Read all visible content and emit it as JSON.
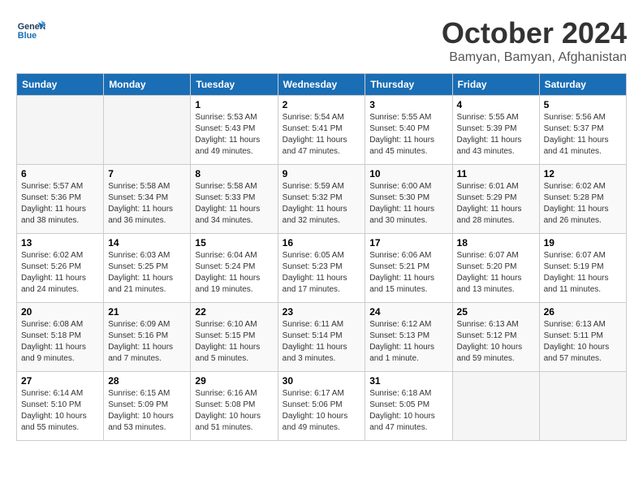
{
  "header": {
    "logo_general": "General",
    "logo_blue": "Blue",
    "month_title": "October 2024",
    "subtitle": "Bamyan, Bamyan, Afghanistan"
  },
  "days_of_week": [
    "Sunday",
    "Monday",
    "Tuesday",
    "Wednesday",
    "Thursday",
    "Friday",
    "Saturday"
  ],
  "weeks": [
    [
      {
        "day": "",
        "info": ""
      },
      {
        "day": "",
        "info": ""
      },
      {
        "day": "1",
        "sunrise": "Sunrise: 5:53 AM",
        "sunset": "Sunset: 5:43 PM",
        "daylight": "Daylight: 11 hours and 49 minutes."
      },
      {
        "day": "2",
        "sunrise": "Sunrise: 5:54 AM",
        "sunset": "Sunset: 5:41 PM",
        "daylight": "Daylight: 11 hours and 47 minutes."
      },
      {
        "day": "3",
        "sunrise": "Sunrise: 5:55 AM",
        "sunset": "Sunset: 5:40 PM",
        "daylight": "Daylight: 11 hours and 45 minutes."
      },
      {
        "day": "4",
        "sunrise": "Sunrise: 5:55 AM",
        "sunset": "Sunset: 5:39 PM",
        "daylight": "Daylight: 11 hours and 43 minutes."
      },
      {
        "day": "5",
        "sunrise": "Sunrise: 5:56 AM",
        "sunset": "Sunset: 5:37 PM",
        "daylight": "Daylight: 11 hours and 41 minutes."
      }
    ],
    [
      {
        "day": "6",
        "sunrise": "Sunrise: 5:57 AM",
        "sunset": "Sunset: 5:36 PM",
        "daylight": "Daylight: 11 hours and 38 minutes."
      },
      {
        "day": "7",
        "sunrise": "Sunrise: 5:58 AM",
        "sunset": "Sunset: 5:34 PM",
        "daylight": "Daylight: 11 hours and 36 minutes."
      },
      {
        "day": "8",
        "sunrise": "Sunrise: 5:58 AM",
        "sunset": "Sunset: 5:33 PM",
        "daylight": "Daylight: 11 hours and 34 minutes."
      },
      {
        "day": "9",
        "sunrise": "Sunrise: 5:59 AM",
        "sunset": "Sunset: 5:32 PM",
        "daylight": "Daylight: 11 hours and 32 minutes."
      },
      {
        "day": "10",
        "sunrise": "Sunrise: 6:00 AM",
        "sunset": "Sunset: 5:30 PM",
        "daylight": "Daylight: 11 hours and 30 minutes."
      },
      {
        "day": "11",
        "sunrise": "Sunrise: 6:01 AM",
        "sunset": "Sunset: 5:29 PM",
        "daylight": "Daylight: 11 hours and 28 minutes."
      },
      {
        "day": "12",
        "sunrise": "Sunrise: 6:02 AM",
        "sunset": "Sunset: 5:28 PM",
        "daylight": "Daylight: 11 hours and 26 minutes."
      }
    ],
    [
      {
        "day": "13",
        "sunrise": "Sunrise: 6:02 AM",
        "sunset": "Sunset: 5:26 PM",
        "daylight": "Daylight: 11 hours and 24 minutes."
      },
      {
        "day": "14",
        "sunrise": "Sunrise: 6:03 AM",
        "sunset": "Sunset: 5:25 PM",
        "daylight": "Daylight: 11 hours and 21 minutes."
      },
      {
        "day": "15",
        "sunrise": "Sunrise: 6:04 AM",
        "sunset": "Sunset: 5:24 PM",
        "daylight": "Daylight: 11 hours and 19 minutes."
      },
      {
        "day": "16",
        "sunrise": "Sunrise: 6:05 AM",
        "sunset": "Sunset: 5:23 PM",
        "daylight": "Daylight: 11 hours and 17 minutes."
      },
      {
        "day": "17",
        "sunrise": "Sunrise: 6:06 AM",
        "sunset": "Sunset: 5:21 PM",
        "daylight": "Daylight: 11 hours and 15 minutes."
      },
      {
        "day": "18",
        "sunrise": "Sunrise: 6:07 AM",
        "sunset": "Sunset: 5:20 PM",
        "daylight": "Daylight: 11 hours and 13 minutes."
      },
      {
        "day": "19",
        "sunrise": "Sunrise: 6:07 AM",
        "sunset": "Sunset: 5:19 PM",
        "daylight": "Daylight: 11 hours and 11 minutes."
      }
    ],
    [
      {
        "day": "20",
        "sunrise": "Sunrise: 6:08 AM",
        "sunset": "Sunset: 5:18 PM",
        "daylight": "Daylight: 11 hours and 9 minutes."
      },
      {
        "day": "21",
        "sunrise": "Sunrise: 6:09 AM",
        "sunset": "Sunset: 5:16 PM",
        "daylight": "Daylight: 11 hours and 7 minutes."
      },
      {
        "day": "22",
        "sunrise": "Sunrise: 6:10 AM",
        "sunset": "Sunset: 5:15 PM",
        "daylight": "Daylight: 11 hours and 5 minutes."
      },
      {
        "day": "23",
        "sunrise": "Sunrise: 6:11 AM",
        "sunset": "Sunset: 5:14 PM",
        "daylight": "Daylight: 11 hours and 3 minutes."
      },
      {
        "day": "24",
        "sunrise": "Sunrise: 6:12 AM",
        "sunset": "Sunset: 5:13 PM",
        "daylight": "Daylight: 11 hours and 1 minute."
      },
      {
        "day": "25",
        "sunrise": "Sunrise: 6:13 AM",
        "sunset": "Sunset: 5:12 PM",
        "daylight": "Daylight: 10 hours and 59 minutes."
      },
      {
        "day": "26",
        "sunrise": "Sunrise: 6:13 AM",
        "sunset": "Sunset: 5:11 PM",
        "daylight": "Daylight: 10 hours and 57 minutes."
      }
    ],
    [
      {
        "day": "27",
        "sunrise": "Sunrise: 6:14 AM",
        "sunset": "Sunset: 5:10 PM",
        "daylight": "Daylight: 10 hours and 55 minutes."
      },
      {
        "day": "28",
        "sunrise": "Sunrise: 6:15 AM",
        "sunset": "Sunset: 5:09 PM",
        "daylight": "Daylight: 10 hours and 53 minutes."
      },
      {
        "day": "29",
        "sunrise": "Sunrise: 6:16 AM",
        "sunset": "Sunset: 5:08 PM",
        "daylight": "Daylight: 10 hours and 51 minutes."
      },
      {
        "day": "30",
        "sunrise": "Sunrise: 6:17 AM",
        "sunset": "Sunset: 5:06 PM",
        "daylight": "Daylight: 10 hours and 49 minutes."
      },
      {
        "day": "31",
        "sunrise": "Sunrise: 6:18 AM",
        "sunset": "Sunset: 5:05 PM",
        "daylight": "Daylight: 10 hours and 47 minutes."
      },
      {
        "day": "",
        "info": ""
      },
      {
        "day": "",
        "info": ""
      }
    ]
  ]
}
